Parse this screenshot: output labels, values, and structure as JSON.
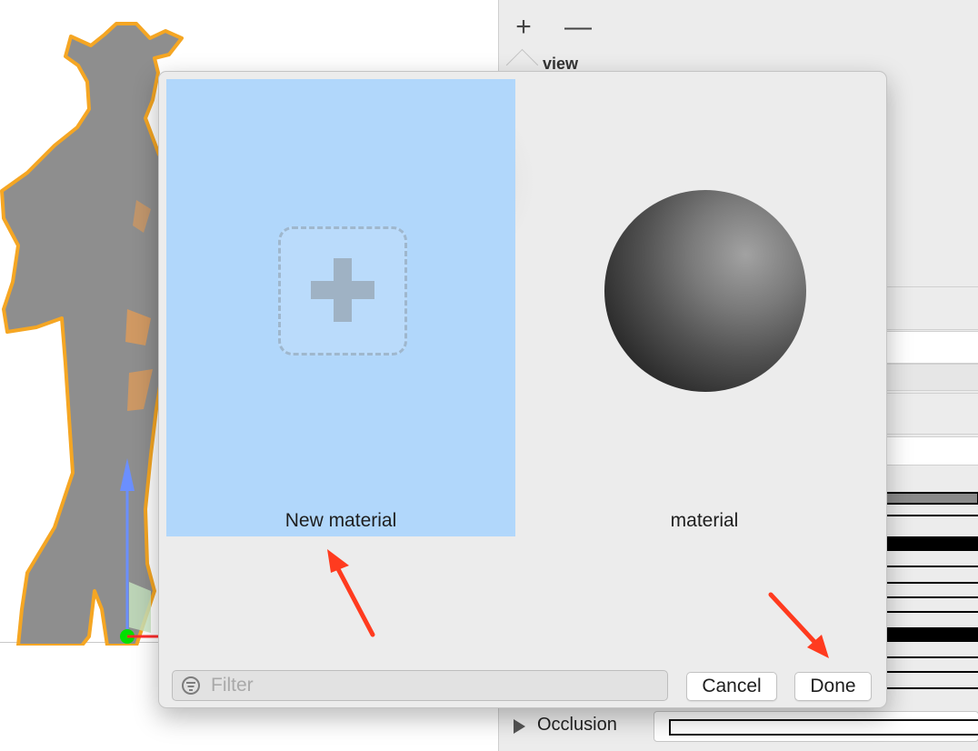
{
  "inspector": {
    "add_symbol": "+",
    "remove_symbol": "—",
    "preview_label": "view",
    "occlusion_label": "Occlusion"
  },
  "popover": {
    "tiles": [
      {
        "label": "New material",
        "selected": true
      },
      {
        "label": "material",
        "selected": false
      }
    ],
    "filter": {
      "placeholder": "Filter",
      "value": ""
    },
    "cancel_label": "Cancel",
    "done_label": "Done"
  },
  "icons": [
    "plus-icon",
    "minus-icon",
    "filter-icon",
    "disclosure-triangle-icon",
    "add-material-icon",
    "material-sphere-icon"
  ],
  "colors": {
    "selection": "#b1d7fb",
    "character_fill": "#8e8e8e",
    "character_outline": "#f5a623",
    "annotation_arrow": "#ff3b1f"
  }
}
